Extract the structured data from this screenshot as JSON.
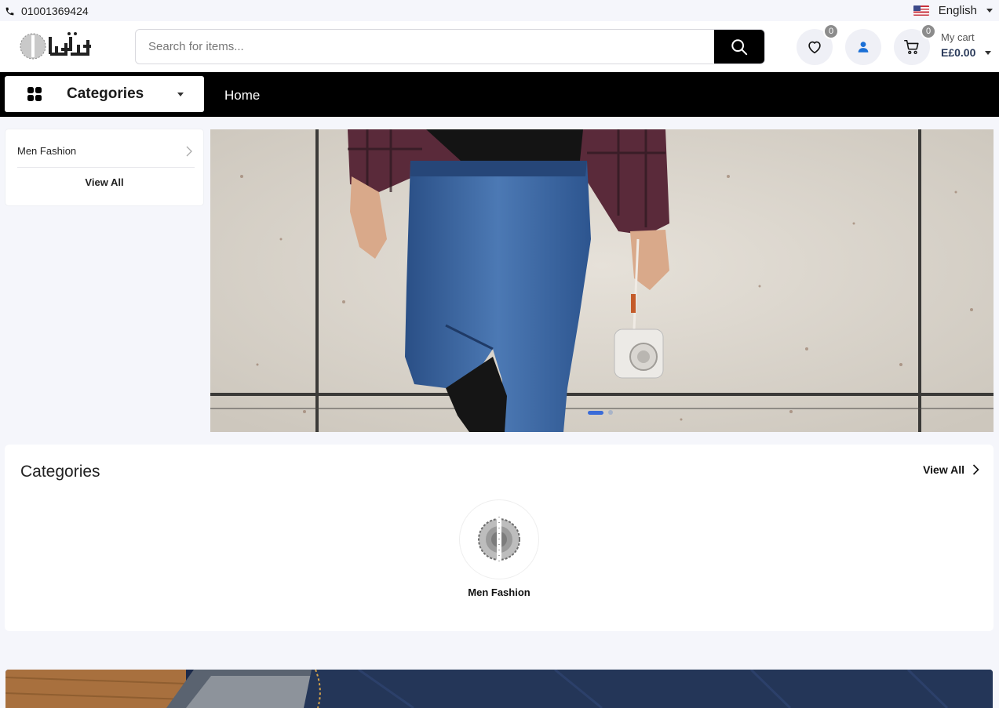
{
  "topbar": {
    "phone": "01001369424",
    "language": "English"
  },
  "header": {
    "search_placeholder": "Search for items...",
    "wishlist_count": "0",
    "cart_count": "0",
    "cart_label": "My cart",
    "cart_total": "E£0.00"
  },
  "nav": {
    "categories_label": "Categories",
    "home_label": "Home"
  },
  "sidebar": {
    "items": [
      {
        "label": "Men Fashion"
      }
    ],
    "view_all": "View All"
  },
  "hero": {
    "slide_count": 2,
    "active_slide": 1
  },
  "categories": {
    "title": "Categories",
    "view_all": "View All",
    "items": [
      {
        "label": "Men Fashion"
      }
    ]
  },
  "colors": {
    "accent": "#3a6bd8",
    "nav_bg": "#000000",
    "page_bg": "#f5f6fb",
    "user_icon": "#1a6fd6"
  }
}
